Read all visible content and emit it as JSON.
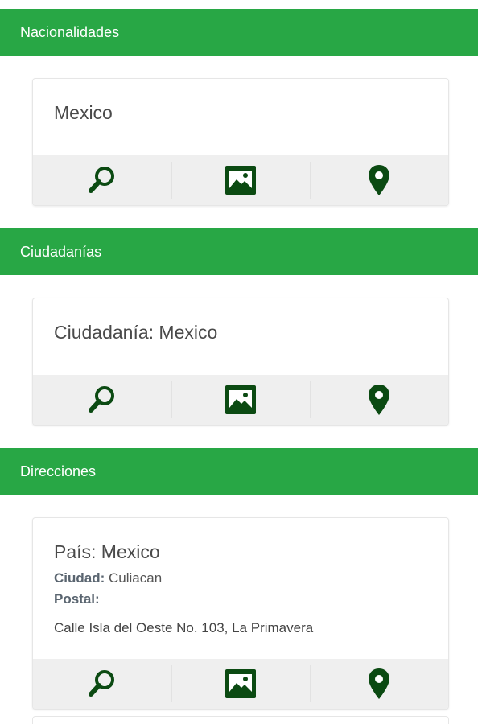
{
  "colors": {
    "header_bg": "#28a745",
    "icon_color": "#0b4a12",
    "footer_bg": "#efefef"
  },
  "sections": {
    "nacionalidades": {
      "title": "Nacionalidades",
      "card_title": "Mexico"
    },
    "ciudadanias": {
      "title": "Ciudadanías",
      "card_title": "Ciudadanía: Mexico"
    },
    "direcciones": {
      "title": "Direcciones",
      "card_title": "País: Mexico",
      "ciudad_label": "Ciudad:",
      "ciudad_value": "Culiacan",
      "postal_label": "Postal:",
      "postal_value": "",
      "address": "Calle Isla del Oeste No. 103, La Primavera"
    }
  },
  "icons": {
    "search": "search-icon",
    "image": "image-icon",
    "location": "map-pin-icon"
  }
}
